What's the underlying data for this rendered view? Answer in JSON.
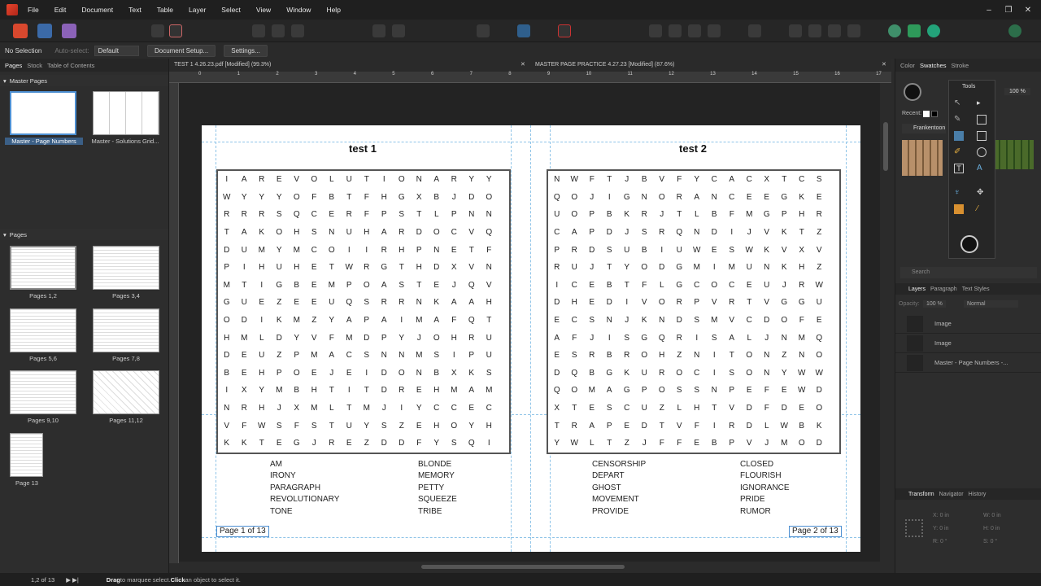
{
  "menu": [
    "File",
    "Edit",
    "Document",
    "Text",
    "Table",
    "Layer",
    "Select",
    "View",
    "Window",
    "Help"
  ],
  "context": {
    "selection": "No Selection",
    "autoselect": "Auto-select:",
    "autoselect_value": "Default",
    "doc_setup": "Document Setup...",
    "settings": "Settings..."
  },
  "left_tabs": [
    "Pages",
    "Stock",
    "Table of Contents"
  ],
  "master_header": "Master Pages",
  "masters": [
    "Master - Page Numbers",
    "Master - Solutions Grid..."
  ],
  "pages_header": "Pages",
  "pages": [
    "Pages 1,2",
    "Pages 3,4",
    "Pages 5,6",
    "Pages 7,8",
    "Pages 9,10",
    "Pages 11,12",
    "Page 13"
  ],
  "doc_tabs": [
    "TEST 1 4.26.23.pdf [Modified] (99.3%)",
    "MASTER PAGE PRACTICE 4.27.23 [Modified] (87.6%)"
  ],
  "ruler_ticks": [
    "0",
    "1",
    "2",
    "3",
    "4",
    "5",
    "6",
    "7",
    "8",
    "9",
    "10",
    "11",
    "12",
    "13",
    "14",
    "15",
    "16",
    "17"
  ],
  "left_page": {
    "title": "test 1",
    "grid": [
      "IAREVOLUTIONARYY",
      "WYYYOFBTFHGXBJDO",
      "RRRSQCERFPSTLPNN",
      "TAKOHSNUHARDOCVQ",
      "DUMYMCOIIRHPNETF",
      "PIHUHETWRGTHDXVN",
      "MTIGBEMPOASTEJQV",
      "GUEZEEUQSRRNKAAH",
      "ODIKMZYAPAIMAFQT",
      "HMLDYVFMDPYJOHRU",
      "DEUZPMACSNNMSIPU",
      "BEHPOEJEIDONBXKS",
      "IXYMBHTITDREHMAM",
      "NRHJXMLTMJIYCCEC",
      "VFWSFSTUYSZEHOYH",
      "KKTEGJREZDDFYSQI"
    ],
    "words_left": [
      "AM",
      "IRONY",
      "PARAGRAPH",
      "REVOLUTIONARY",
      "TONE"
    ],
    "words_right": [
      "BLONDE",
      "MEMORY",
      "PETTY",
      "SQUEEZE",
      "TRIBE"
    ],
    "page_num": "Page 1 of 13"
  },
  "right_page": {
    "title": "test 2",
    "grid": [
      "NWFTJBVFYCACXTCS",
      "QOJIGNORANCEEGKE",
      "UOPBKRJTLBFMGPHR",
      "CAPDJSRQNDIJVKTZ",
      "PRDSUBIUWESWKVXV",
      "RUJTYODGMIMUNKHZ",
      "ICEBTFLGCOCEUJRW",
      "DHEDIVORPVRTVGGU",
      "ECSNJKNDSMVCDOFE",
      "AFJISGQRISALJNMQ",
      "ESRBROHZNITONZNO",
      "DQBGKUROCISONYWW",
      "QOMAGPOSSNPEFEWD",
      "XTESCUZLHTVDFDEO",
      "TRAPEDTVFIRDLWBK",
      "YWLTZJFFEBPVJMOD"
    ],
    "words_left": [
      "CENSORSHIP",
      "DEPART",
      "GHOST",
      "MOVEMENT",
      "PROVIDE"
    ],
    "words_right": [
      "CLOSED",
      "FLOURISH",
      "IGNORANCE",
      "PRIDE",
      "RUMOR"
    ],
    "page_num": "Page 2 of 13"
  },
  "right_tabs": [
    "Color",
    "Swatches",
    "Stroke"
  ],
  "tools_title": "Tools",
  "recent": "Recent:",
  "swatch_name": "Frankentoon",
  "opacity_val": "100 %",
  "search_placeholder": "Search",
  "layer_tabs": [
    "Layers",
    "Paragraph",
    "Text Styles"
  ],
  "layer_opacity": "Opacity:",
  "layer_opacity_val": "100 %",
  "blend": "Normal",
  "layers": [
    "Image",
    "Image",
    "Master - Page Numbers -..."
  ],
  "transform_tabs": [
    "Transform",
    "Navigator",
    "History"
  ],
  "transform": {
    "x": "X:",
    "xv": "0 in",
    "y": "Y:",
    "yv": "0 in",
    "w": "W:",
    "wv": "0 in",
    "h": "H:",
    "hv": "0 in",
    "r": "R:",
    "rv": "0 °",
    "s": "S:",
    "sv": "0 °"
  },
  "status": {
    "page": "1,2 of 13",
    "drag": "Drag",
    "t1": " to marquee select. ",
    "click": "Click",
    "t2": " an object to select it."
  },
  "colors": {
    "accent": "#4d8fd1",
    "app_red": "#e8442c"
  }
}
